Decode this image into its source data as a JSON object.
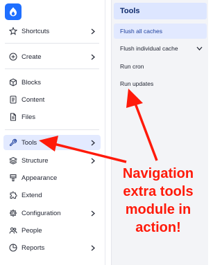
{
  "sidebar": {
    "items": [
      {
        "label": "Shortcuts",
        "icon": "star-icon",
        "has_chevron": true
      },
      {
        "label": "Create",
        "icon": "plus-circle-icon",
        "has_chevron": true
      },
      {
        "label": "Blocks",
        "icon": "cube-icon",
        "has_chevron": false
      },
      {
        "label": "Content",
        "icon": "document-icon",
        "has_chevron": false
      },
      {
        "label": "Files",
        "icon": "file-icon",
        "has_chevron": false
      },
      {
        "label": "Tools",
        "icon": "wrench-icon",
        "has_chevron": true,
        "active": true
      },
      {
        "label": "Structure",
        "icon": "layers-icon",
        "has_chevron": true
      },
      {
        "label": "Appearance",
        "icon": "brush-icon",
        "has_chevron": false
      },
      {
        "label": "Extend",
        "icon": "puzzle-icon",
        "has_chevron": false
      },
      {
        "label": "Configuration",
        "icon": "gear-icon",
        "has_chevron": true
      },
      {
        "label": "People",
        "icon": "people-icon",
        "has_chevron": false
      },
      {
        "label": "Reports",
        "icon": "pie-chart-icon",
        "has_chevron": true
      }
    ]
  },
  "panel": {
    "title": "Tools",
    "items": [
      {
        "label": "Flush all caches",
        "active": true,
        "has_chevron": false
      },
      {
        "label": "Flush individual cache",
        "active": false,
        "has_chevron": true
      },
      {
        "label": "Run cron",
        "active": false,
        "has_chevron": false
      },
      {
        "label": "Run updates",
        "active": false,
        "has_chevron": false
      }
    ]
  },
  "annotation": {
    "lines": [
      "Navigation",
      "extra tools",
      "module in",
      "action!"
    ],
    "color": "#ff1a0a"
  },
  "colors": {
    "brand": "#1f6fff",
    "active_bg": "#e3eaff",
    "panel_bg": "#f3f4f7"
  }
}
